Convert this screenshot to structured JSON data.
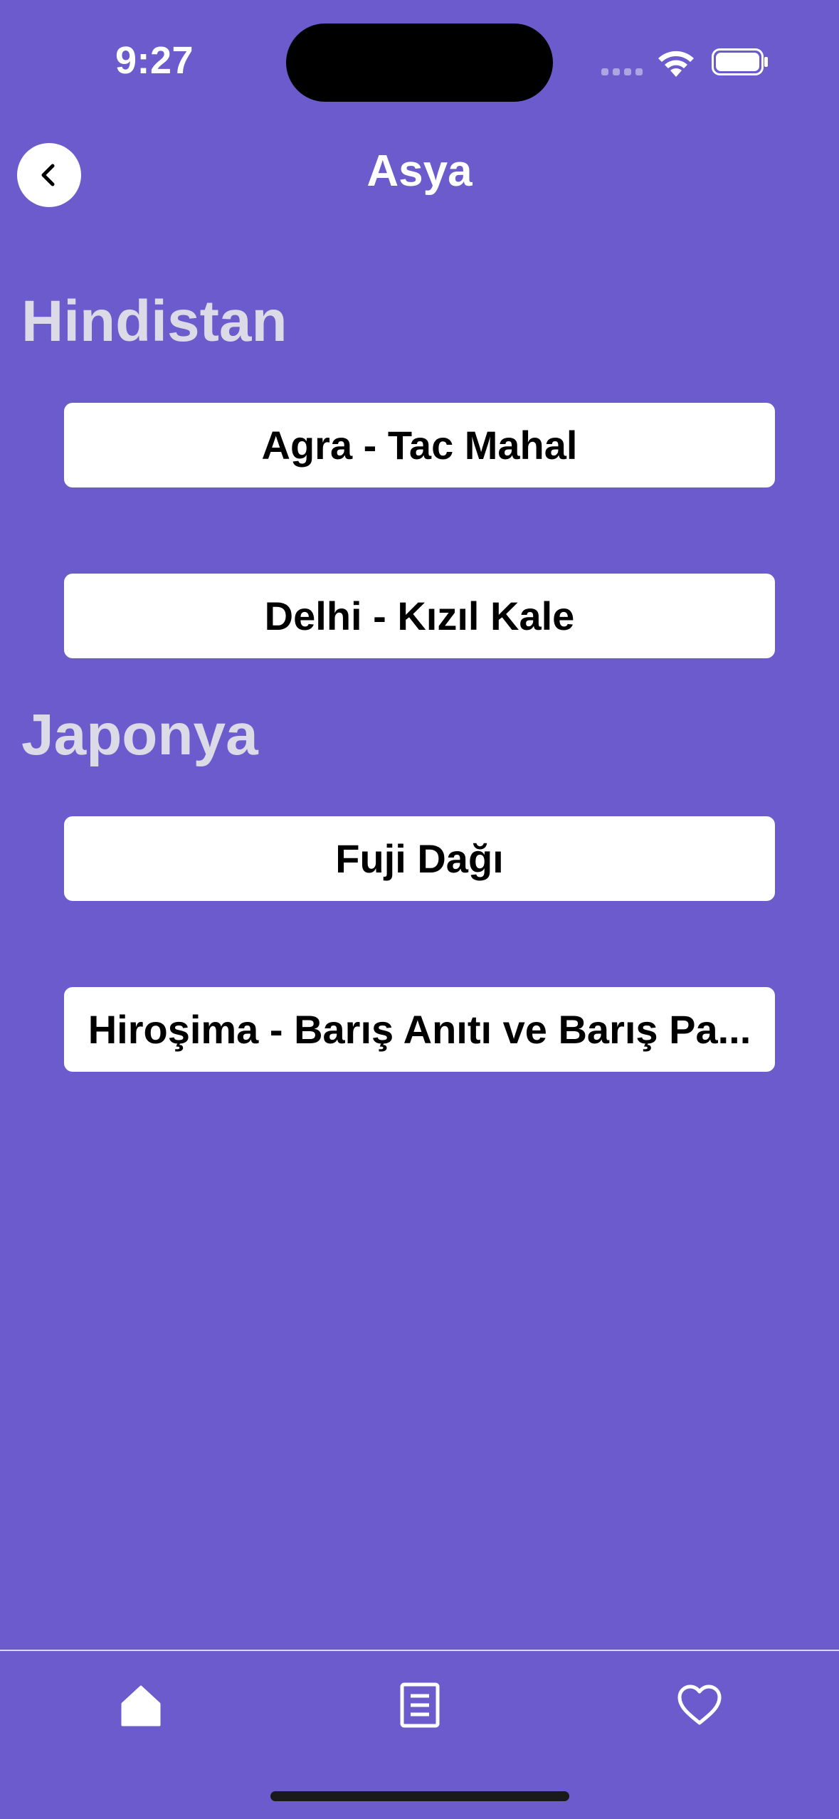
{
  "status_bar": {
    "time": "9:27"
  },
  "header": {
    "title": "Asya",
    "back_icon": "chevron-left-icon"
  },
  "sections": [
    {
      "title": "Hindistan",
      "items": [
        "Agra - Tac Mahal",
        "Delhi - Kızıl Kale"
      ]
    },
    {
      "title": "Japonya",
      "items": [
        "Fuji Dağı",
        "Hiroşima - Barış Anıtı ve Barış Pa..."
      ]
    }
  ],
  "tab_bar": {
    "tabs": [
      {
        "icon": "home-icon"
      },
      {
        "icon": "document-icon"
      },
      {
        "icon": "heart-icon"
      }
    ]
  },
  "colors": {
    "background": "#6b5bcd",
    "section_title": "#dcdae6",
    "button_bg": "#ffffff",
    "button_text": "#000000"
  }
}
